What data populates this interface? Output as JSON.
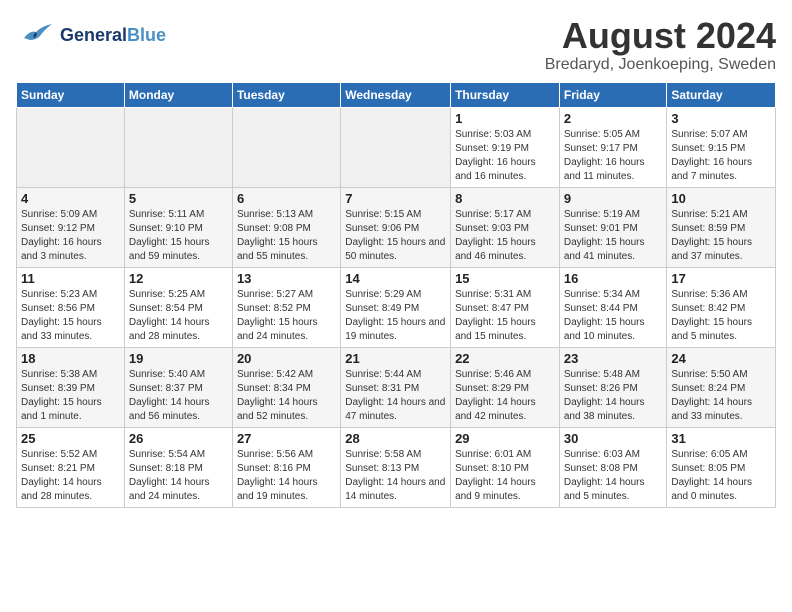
{
  "header": {
    "logo_line1": "General",
    "logo_line2": "Blue",
    "month_year": "August 2024",
    "location": "Bredaryd, Joenkoeping, Sweden"
  },
  "weekdays": [
    "Sunday",
    "Monday",
    "Tuesday",
    "Wednesday",
    "Thursday",
    "Friday",
    "Saturday"
  ],
  "weeks": [
    [
      {
        "day": "",
        "empty": true
      },
      {
        "day": "",
        "empty": true
      },
      {
        "day": "",
        "empty": true
      },
      {
        "day": "",
        "empty": true
      },
      {
        "day": "1",
        "sunrise": "5:03 AM",
        "sunset": "9:19 PM",
        "daylight": "16 hours and 16 minutes."
      },
      {
        "day": "2",
        "sunrise": "5:05 AM",
        "sunset": "9:17 PM",
        "daylight": "16 hours and 11 minutes."
      },
      {
        "day": "3",
        "sunrise": "5:07 AM",
        "sunset": "9:15 PM",
        "daylight": "16 hours and 7 minutes."
      }
    ],
    [
      {
        "day": "4",
        "sunrise": "5:09 AM",
        "sunset": "9:12 PM",
        "daylight": "16 hours and 3 minutes."
      },
      {
        "day": "5",
        "sunrise": "5:11 AM",
        "sunset": "9:10 PM",
        "daylight": "15 hours and 59 minutes."
      },
      {
        "day": "6",
        "sunrise": "5:13 AM",
        "sunset": "9:08 PM",
        "daylight": "15 hours and 55 minutes."
      },
      {
        "day": "7",
        "sunrise": "5:15 AM",
        "sunset": "9:06 PM",
        "daylight": "15 hours and 50 minutes."
      },
      {
        "day": "8",
        "sunrise": "5:17 AM",
        "sunset": "9:03 PM",
        "daylight": "15 hours and 46 minutes."
      },
      {
        "day": "9",
        "sunrise": "5:19 AM",
        "sunset": "9:01 PM",
        "daylight": "15 hours and 41 minutes."
      },
      {
        "day": "10",
        "sunrise": "5:21 AM",
        "sunset": "8:59 PM",
        "daylight": "15 hours and 37 minutes."
      }
    ],
    [
      {
        "day": "11",
        "sunrise": "5:23 AM",
        "sunset": "8:56 PM",
        "daylight": "15 hours and 33 minutes."
      },
      {
        "day": "12",
        "sunrise": "5:25 AM",
        "sunset": "8:54 PM",
        "daylight": "14 hours and 28 minutes."
      },
      {
        "day": "13",
        "sunrise": "5:27 AM",
        "sunset": "8:52 PM",
        "daylight": "15 hours and 24 minutes."
      },
      {
        "day": "14",
        "sunrise": "5:29 AM",
        "sunset": "8:49 PM",
        "daylight": "15 hours and 19 minutes."
      },
      {
        "day": "15",
        "sunrise": "5:31 AM",
        "sunset": "8:47 PM",
        "daylight": "15 hours and 15 minutes."
      },
      {
        "day": "16",
        "sunrise": "5:34 AM",
        "sunset": "8:44 PM",
        "daylight": "15 hours and 10 minutes."
      },
      {
        "day": "17",
        "sunrise": "5:36 AM",
        "sunset": "8:42 PM",
        "daylight": "15 hours and 5 minutes."
      }
    ],
    [
      {
        "day": "18",
        "sunrise": "5:38 AM",
        "sunset": "8:39 PM",
        "daylight": "15 hours and 1 minute."
      },
      {
        "day": "19",
        "sunrise": "5:40 AM",
        "sunset": "8:37 PM",
        "daylight": "14 hours and 56 minutes."
      },
      {
        "day": "20",
        "sunrise": "5:42 AM",
        "sunset": "8:34 PM",
        "daylight": "14 hours and 52 minutes."
      },
      {
        "day": "21",
        "sunrise": "5:44 AM",
        "sunset": "8:31 PM",
        "daylight": "14 hours and 47 minutes."
      },
      {
        "day": "22",
        "sunrise": "5:46 AM",
        "sunset": "8:29 PM",
        "daylight": "14 hours and 42 minutes."
      },
      {
        "day": "23",
        "sunrise": "5:48 AM",
        "sunset": "8:26 PM",
        "daylight": "14 hours and 38 minutes."
      },
      {
        "day": "24",
        "sunrise": "5:50 AM",
        "sunset": "8:24 PM",
        "daylight": "14 hours and 33 minutes."
      }
    ],
    [
      {
        "day": "25",
        "sunrise": "5:52 AM",
        "sunset": "8:21 PM",
        "daylight": "14 hours and 28 minutes."
      },
      {
        "day": "26",
        "sunrise": "5:54 AM",
        "sunset": "8:18 PM",
        "daylight": "14 hours and 24 minutes."
      },
      {
        "day": "27",
        "sunrise": "5:56 AM",
        "sunset": "8:16 PM",
        "daylight": "14 hours and 19 minutes."
      },
      {
        "day": "28",
        "sunrise": "5:58 AM",
        "sunset": "8:13 PM",
        "daylight": "14 hours and 14 minutes."
      },
      {
        "day": "29",
        "sunrise": "6:01 AM",
        "sunset": "8:10 PM",
        "daylight": "14 hours and 9 minutes."
      },
      {
        "day": "30",
        "sunrise": "6:03 AM",
        "sunset": "8:08 PM",
        "daylight": "14 hours and 5 minutes."
      },
      {
        "day": "31",
        "sunrise": "6:05 AM",
        "sunset": "8:05 PM",
        "daylight": "14 hours and 0 minutes."
      }
    ]
  ],
  "labels": {
    "sunrise_label": "Sunrise:",
    "sunset_label": "Sunset:",
    "daylight_label": "Daylight:"
  }
}
